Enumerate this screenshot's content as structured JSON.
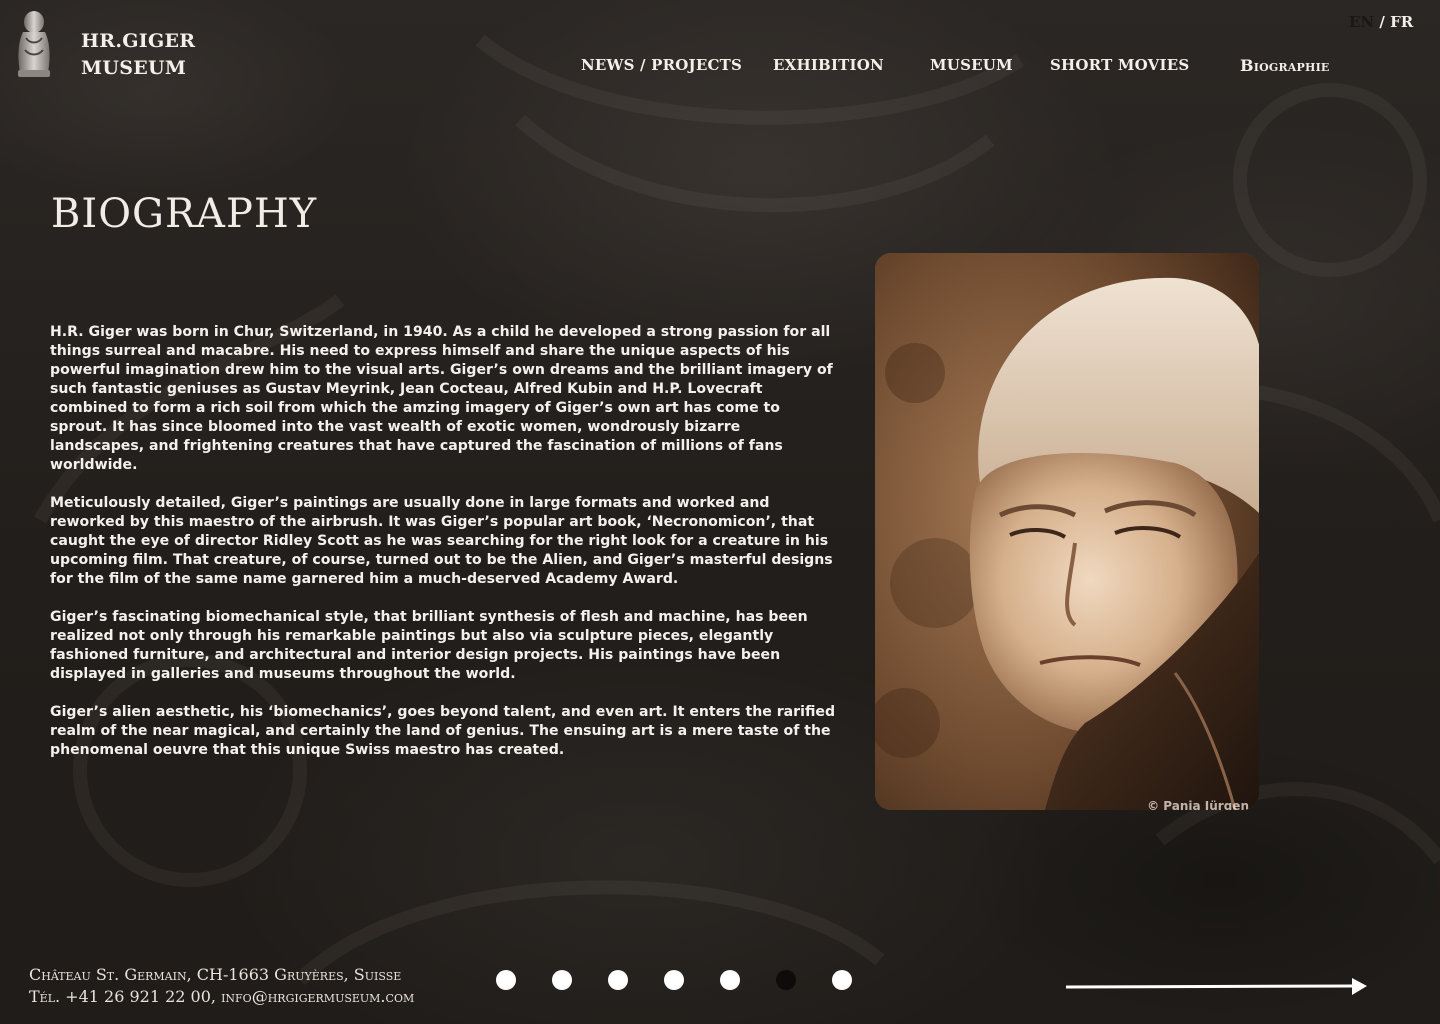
{
  "brand": {
    "line1": "HR.GIGER",
    "line2": "MUSEUM"
  },
  "language": {
    "en": "EN",
    "separator": "/",
    "fr": "FR",
    "active": "EN"
  },
  "nav": {
    "items": [
      {
        "label": "NEWS / PROJECTS"
      },
      {
        "label": "EXHIBITION"
      },
      {
        "label": "MUSEUM"
      },
      {
        "label": "SHORT MOVIES"
      },
      {
        "label": "Biographie"
      }
    ]
  },
  "page": {
    "title": "BIOGRAPHY",
    "paragraphs": [
      "H.R. Giger was born in Chur, Switzerland, in 1940. As a child he developed a strong passion for all things surreal and macabre. His need to express himself and share the unique aspects of his powerful imagination drew him to the visual arts. Giger’s own dreams and the brilliant imagery of such fantastic geniuses as Gustav Meyrink, Jean Cocteau, Alfred Kubin and H.P. Lovecraft combined to form a rich soil from which the amzing imagery of Giger’s own art has come to sprout. It has since bloomed into the vast wealth of exotic women, wondrously bizarre landscapes, and frightening creatures that have captured the fascination of millions of fans worldwide.",
      "Meticulously detailed, Giger’s paintings are usually done in large formats and worked and reworked by this maestro of the airbrush. It was Giger’s popular art book, ‘Necronomicon’, that caught the eye of director Ridley Scott as he was searching for the right look for a creature in his upcoming film. That creature, of course, turned out to be the Alien, and Giger’s masterful designs for the film of the same name garnered him a much-deserved Academy Award.",
      "Giger’s fascinating biomechanical style, that brilliant synthesis of flesh and machine, has been realized not only through his remarkable paintings but also via sculpture pieces, elegantly fashioned furniture, and architectural and interior design projects. His paintings have been displayed in galleries and museums throughout the world.",
      "Giger’s alien aesthetic, his ‘biomechanics’, goes beyond talent, and even art. It enters the rarified realm of the near magical, and certainly the land of genius. The ensuing art is a mere taste of the phenomenal oeuvre that this unique Swiss maestro has created."
    ],
    "photo_credit": "© Pania Jürgen"
  },
  "footer": {
    "address": "Château St. Germain, CH-1663 Gruyères, Suisse",
    "contact": "Tél. +41 26 921 22 00, info@hrgigermuseum.com"
  },
  "pagination": {
    "count": 7,
    "active_index": 5
  },
  "colors": {
    "background": "#26221f",
    "text": "#f4efe9",
    "dot": "#ffffff",
    "dot_active": "#0d0c0b"
  },
  "icons": {
    "logo": "giger-sculpture-logo-icon",
    "next": "arrow-right-icon"
  }
}
